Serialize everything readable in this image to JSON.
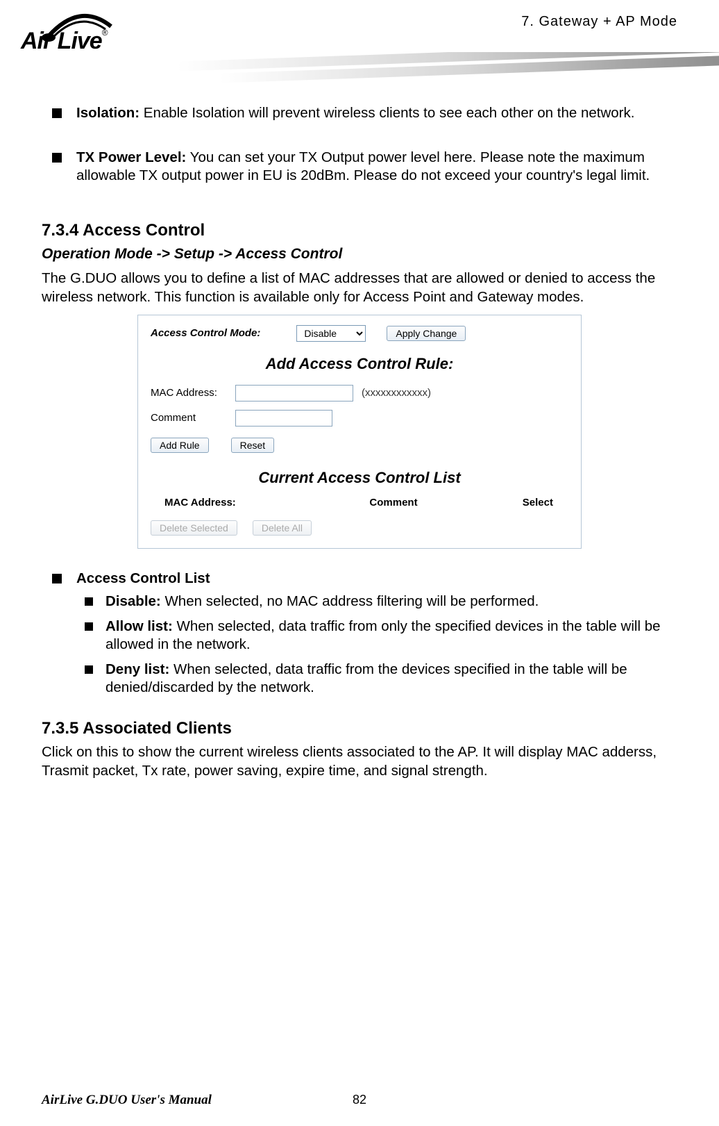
{
  "header": {
    "section_ref": "7.  Gateway  +  AP    Mode",
    "logo_text": "Air Live",
    "logo_reg": "®"
  },
  "bullets": {
    "isolation_label": "Isolation:",
    "isolation_text": "    Enable Isolation will prevent wireless clients to see each other on the network.",
    "tx_label": "TX Power Level:",
    "tx_text": "    You can set your TX Output power level here.    Please note the maximum allowable TX output power in EU is 20dBm.    Please do not exceed your country's legal limit."
  },
  "s734": {
    "heading": "7.3.4 Access Control",
    "path": "Operation Mode -> Setup -> Access Control",
    "para": "The G.DUO allows you to define a list of MAC addresses that are allowed or denied to access the wireless network.    This function is available only for Access Point and Gateway modes."
  },
  "figure": {
    "acm_label": "Access Control Mode:",
    "acm_value": "Disable",
    "apply": "Apply Change",
    "add_title": "Add Access Control Rule:",
    "mac_label": "MAC Address:",
    "mac_hint": "(xxxxxxxxxxxx)",
    "comment_label": "Comment",
    "add_rule": "Add Rule",
    "reset": "Reset",
    "list_title": "Current Access Control List",
    "col_mac": "MAC Address:",
    "col_comment": "Comment",
    "col_select": "Select",
    "delete_selected": "Delete Selected",
    "delete_all": "Delete All"
  },
  "acl": {
    "title": "Access Control List",
    "disable_label": "Disable:",
    "disable_text": " When selected, no MAC address filtering will be performed.",
    "allow_label": "Allow list:",
    "allow_text": " When selected, data traffic from only the specified devices in the table will be allowed in the network.",
    "deny_label": "Deny list:",
    "deny_text": " When selected, data traffic from the devices specified in the table will be denied/discarded by the network."
  },
  "s735": {
    "heading": "7.3.5 Associated Clients",
    "para": "Click on this to show the current wireless clients associated to the AP.    It will display MAC adderss, Trasmit packet, Tx rate, power saving, expire time, and signal strength."
  },
  "footer": {
    "left": "AirLive G.DUO User's Manual",
    "page": "82"
  }
}
